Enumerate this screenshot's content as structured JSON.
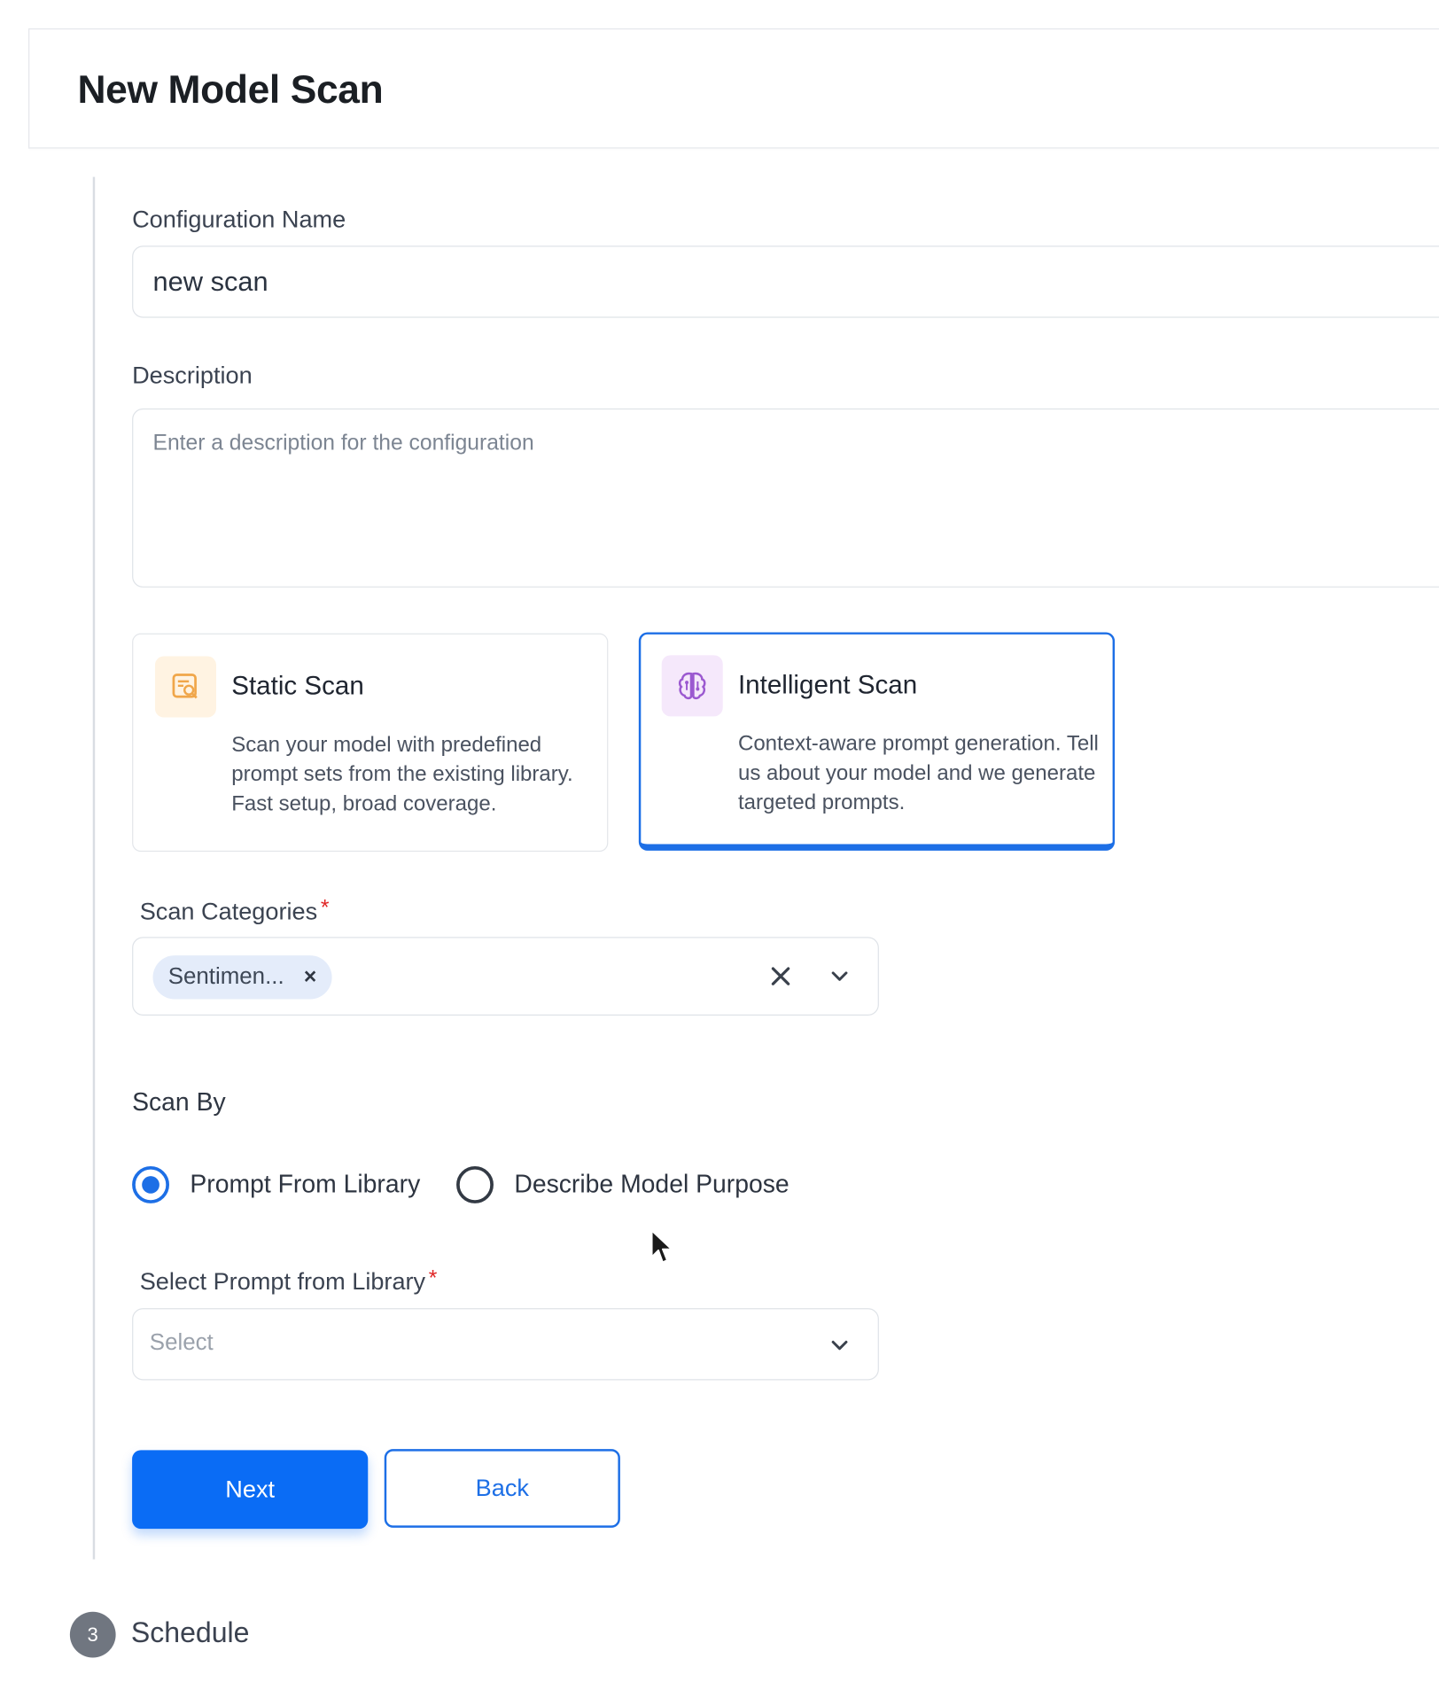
{
  "header": {
    "title": "New Model Scan"
  },
  "form": {
    "config_name": {
      "label": "Configuration Name",
      "value": "new scan"
    },
    "description": {
      "label": "Description",
      "placeholder": "Enter a description for the configuration"
    },
    "scan_types": [
      {
        "title": "Static Scan",
        "description": "Scan your model with predefined prompt sets from the existing library. Fast setup, broad coverage.",
        "icon": "document-search-icon",
        "icon_color": "#f0a64a",
        "icon_bg": "#fff3e2",
        "selected": false
      },
      {
        "title": "Intelligent Scan",
        "description": "Context-aware prompt generation. Tell us about your model and we generate targeted prompts.",
        "icon": "brain-icon",
        "icon_color": "#9b59d0",
        "icon_bg": "#f5e8fb",
        "selected": true
      }
    ],
    "scan_categories": {
      "label": "Scan Categories",
      "required_mark": "*",
      "chips": [
        "Sentimen..."
      ],
      "chip_remove_glyph": "×",
      "clear_glyph": "✕"
    },
    "scan_by": {
      "label": "Scan By",
      "options": [
        {
          "label": "Prompt From Library",
          "selected": true
        },
        {
          "label": "Describe Model Purpose",
          "selected": false
        }
      ]
    },
    "prompt_library": {
      "label": "Select Prompt from Library",
      "required_mark": "*",
      "placeholder": "Select"
    },
    "buttons": {
      "next": "Next",
      "back": "Back"
    }
  },
  "steps": {
    "next_step_number": "3",
    "next_step_label": "Schedule"
  },
  "colors": {
    "accent": "#0a6cf5",
    "required": "#e02424",
    "chip_bg": "#e4ecfa"
  }
}
